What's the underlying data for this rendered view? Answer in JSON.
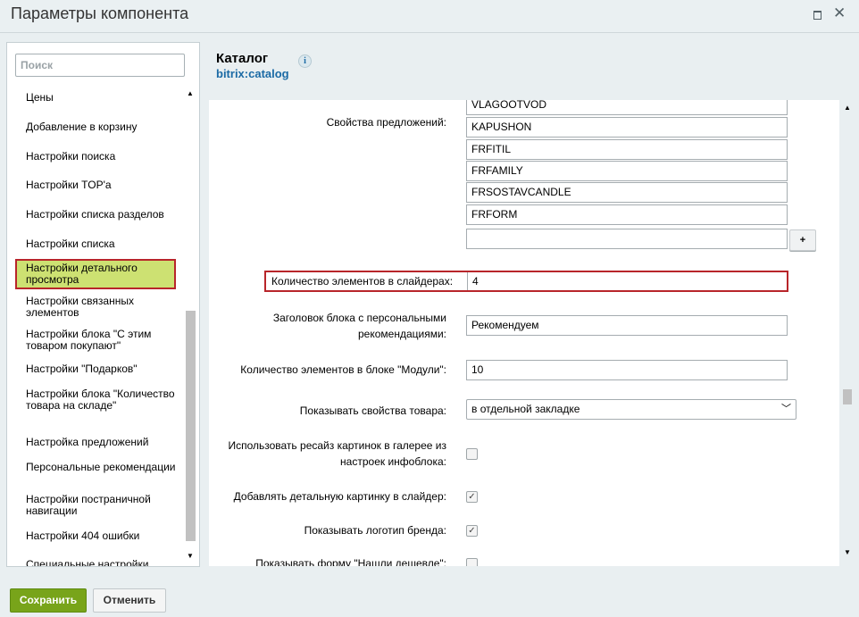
{
  "window": {
    "title": "Параметры компонента"
  },
  "sidebar": {
    "search_placeholder": "Поиск",
    "items": [
      {
        "label": "Цены"
      },
      {
        "label": "Добавление в корзину"
      },
      {
        "label": "Настройки поиска"
      },
      {
        "label": "Настройки TOP'а"
      },
      {
        "label": "Настройки списка разделов"
      },
      {
        "label": "Настройки списка"
      },
      {
        "label": "Настройки детального просмотра",
        "active": true
      },
      {
        "label": "Настройки связанных элементов"
      },
      {
        "label": "Настройки блока \"С этим товаром покупают\""
      },
      {
        "label": "Настройки \"Подарков\""
      },
      {
        "label": "Настройки блока \"Количество товара на складе\""
      },
      {
        "label": "Настройка предложений"
      },
      {
        "label": "Персональные рекомендации"
      },
      {
        "label": "Настройки постраничной навигации"
      },
      {
        "label": "Настройки 404 ошибки"
      },
      {
        "label": "Специальные настройки"
      }
    ]
  },
  "component": {
    "title": "Каталог",
    "code": "bitrix:catalog",
    "info_icon": "i"
  },
  "form": {
    "offer_props_label": "Свойства предложений:",
    "offer_props": [
      "VLAGOOTVOD",
      "KAPUSHON",
      "FRFITIL",
      "FRFAMILY",
      "FRSOSTAVCANDLE",
      "FRFORM",
      ""
    ],
    "plus_label": "+",
    "slider_count_label": "Количество элементов в слайдерах:",
    "slider_count": "4",
    "personal_header_label": "Заголовок блока с персональными рекомендациями:",
    "personal_header": "Рекомендуем",
    "modules_count_label": "Количество элементов в блоке \"Модули\":",
    "modules_count": "10",
    "show_props_label": "Показывать свойства товара:",
    "show_props_value": "в отдельной закладке",
    "resize_label": "Использовать ресайз картинок в галерее из настроек инфоблока:",
    "resize_checked": false,
    "detail_pic_label": "Добавлять детальную картинку в слайдер:",
    "detail_pic_checked": true,
    "brand_logo_label": "Показывать логотип бренда:",
    "brand_logo_checked": true,
    "cheaper_label": "Показывать форму \"Нашли дешевле\":"
  },
  "footer": {
    "save_label": "Сохранить",
    "cancel_label": "Отменить"
  },
  "colors": {
    "save_button": "#78a41a",
    "active_item": "#cde172",
    "highlight_border": "#b8252a",
    "link": "#1b6aa5"
  }
}
